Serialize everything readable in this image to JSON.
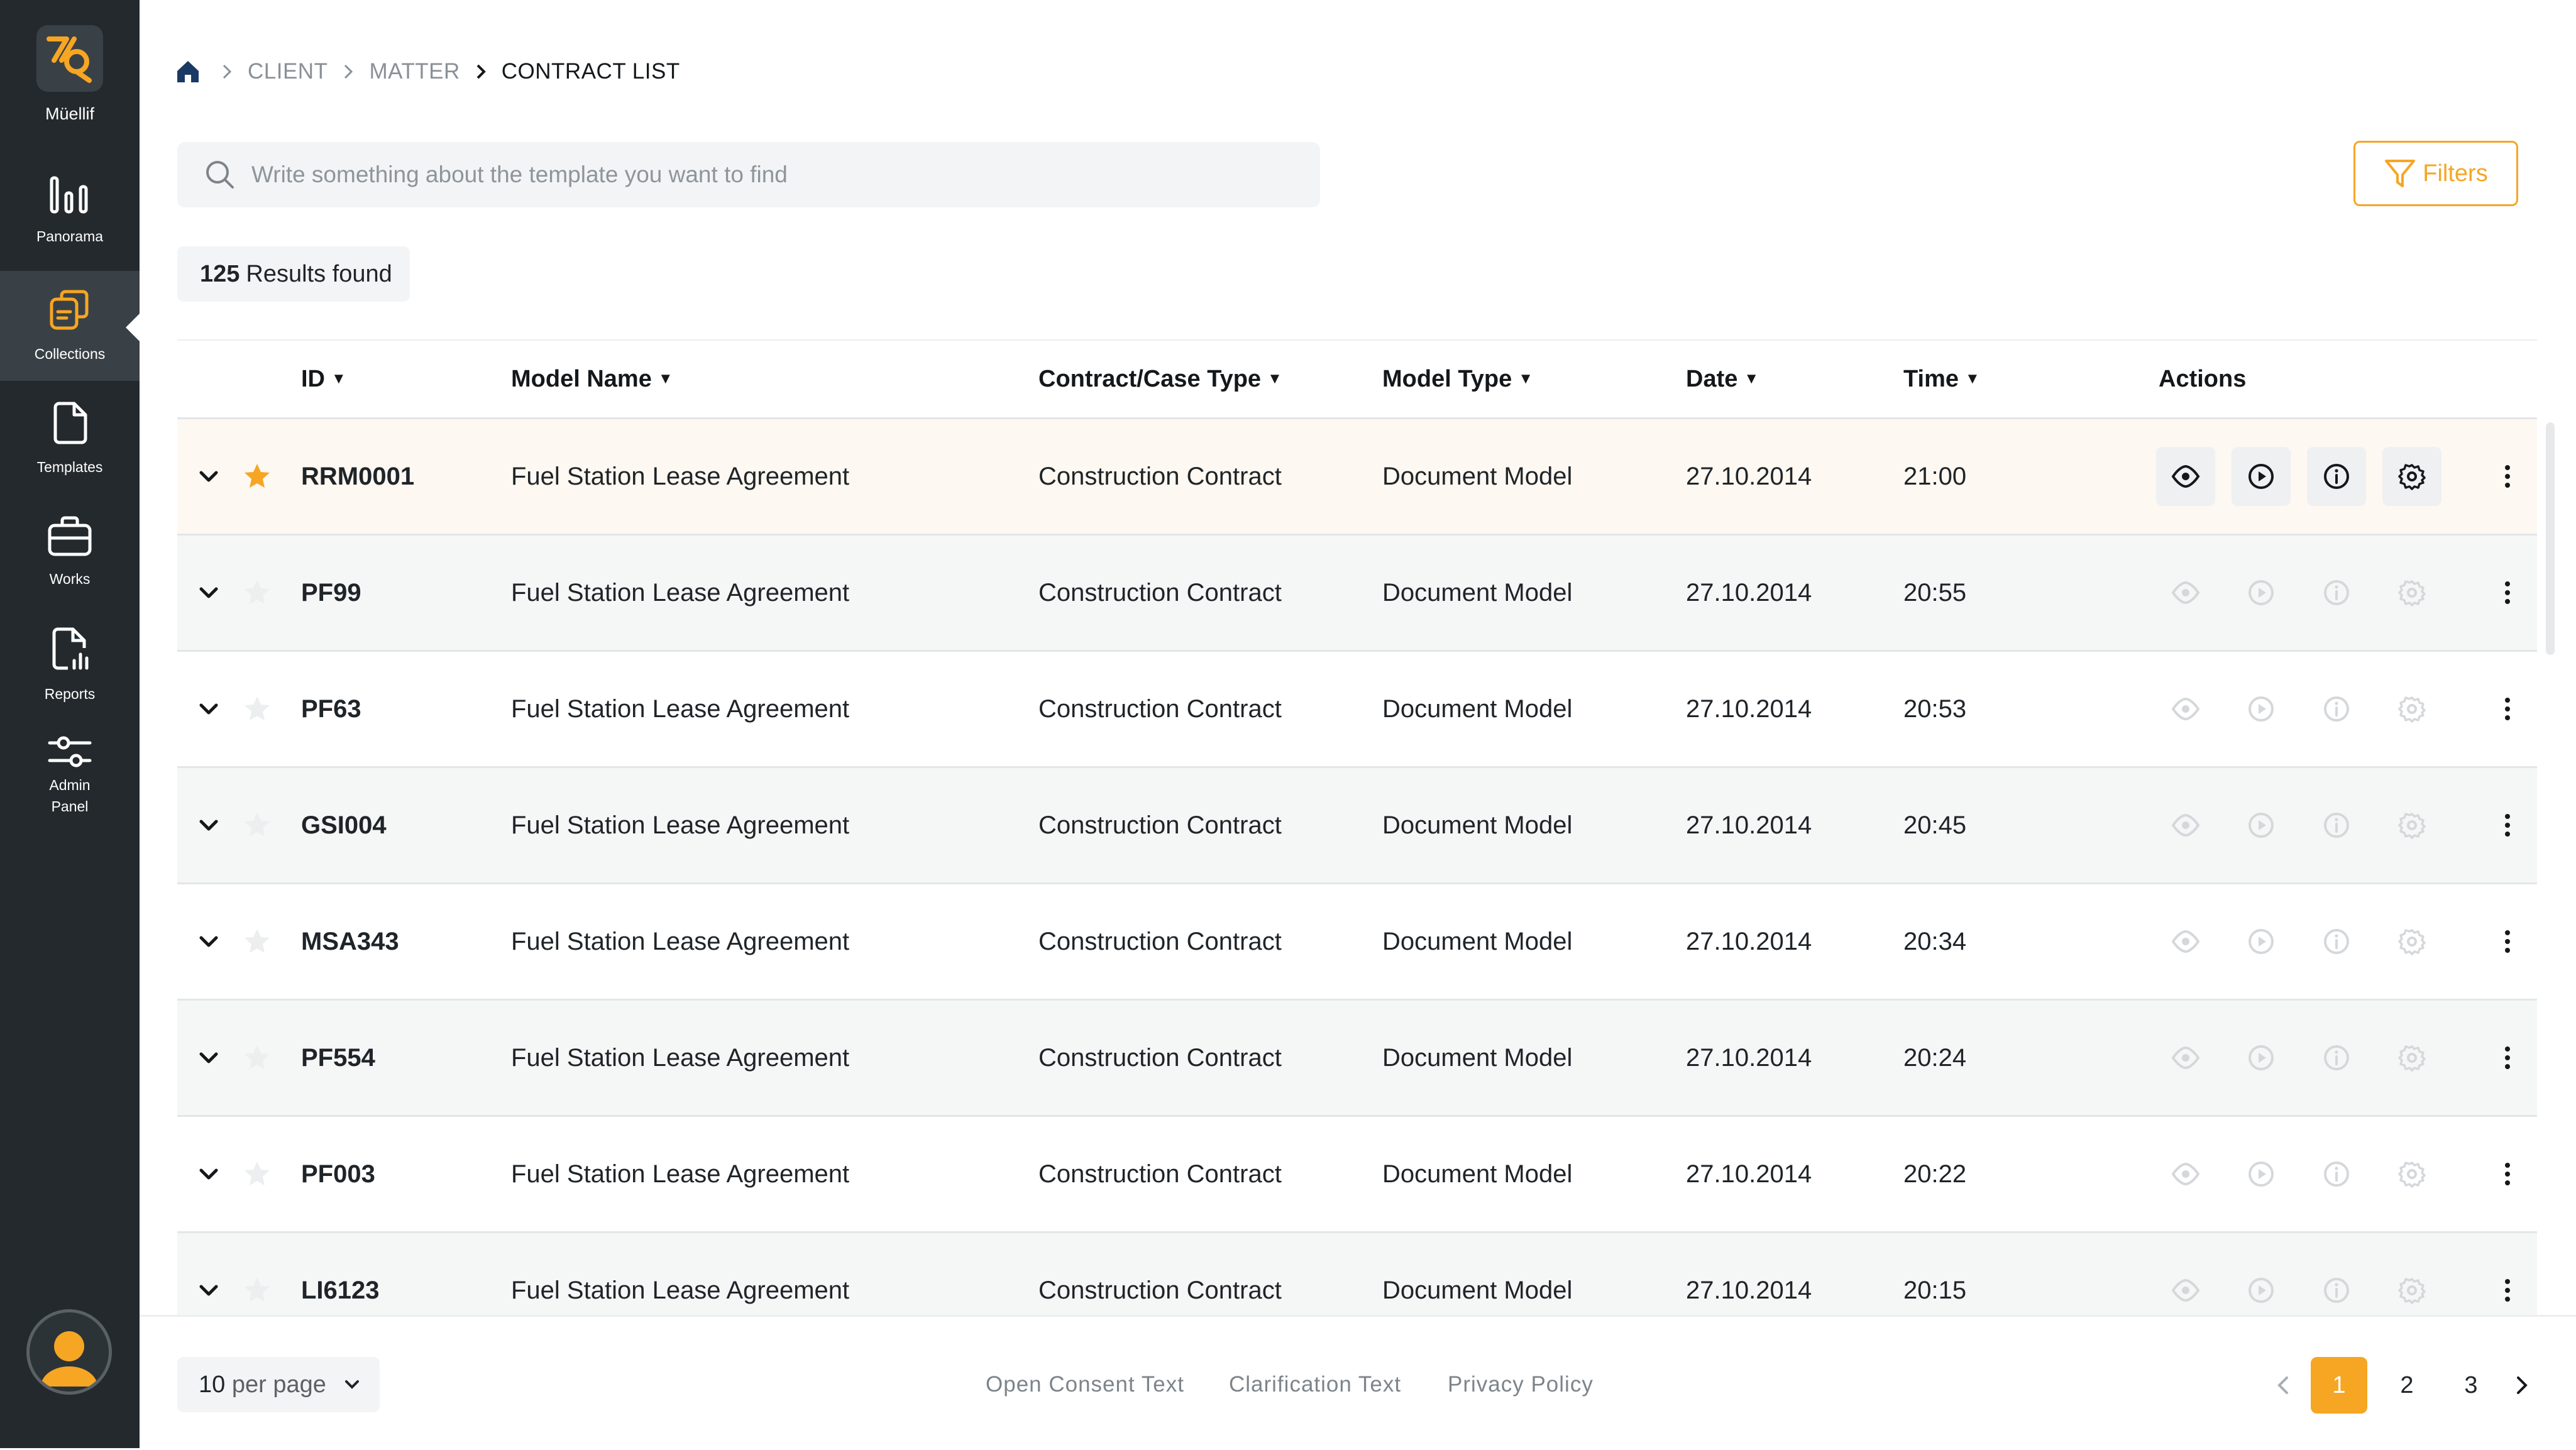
{
  "app": {
    "name": "Müellif",
    "brand_color": "#f6a623",
    "sidebar_color": "#23292d"
  },
  "sidebar": {
    "items": [
      {
        "label": "Panorama",
        "icon": "chart-bars-icon"
      },
      {
        "label": "Collections",
        "icon": "collections-icon",
        "active": true
      },
      {
        "label": "Templates",
        "icon": "document-icon"
      },
      {
        "label": "Works",
        "icon": "briefcase-icon"
      },
      {
        "label": "Reports",
        "icon": "report-icon"
      },
      {
        "label": "Admin Panel",
        "icon": "sliders-icon"
      }
    ]
  },
  "breadcrumb": {
    "items": [
      "CLIENT",
      "MATTER",
      "CONTRACT LIST"
    ]
  },
  "search": {
    "placeholder": "Write something about the template you want to find"
  },
  "filters": {
    "label": "Filters"
  },
  "results": {
    "count": "125",
    "label": "Results found"
  },
  "table": {
    "columns": {
      "id": "ID",
      "model_name": "Model Name",
      "contract_type": "Contract/Case Type",
      "model_type": "Model Type",
      "date": "Date",
      "time": "Time",
      "actions": "Actions"
    },
    "rows": [
      {
        "id": "RRM0001",
        "model_name": "Fuel Station Lease Agreement",
        "contract_type": "Construction Contract",
        "model_type": "Document Model",
        "date": "27.10.2014",
        "time": "21:00",
        "starred": true
      },
      {
        "id": "PF99",
        "model_name": "Fuel Station Lease Agreement",
        "contract_type": "Construction Contract",
        "model_type": "Document Model",
        "date": "27.10.2014",
        "time": "20:55",
        "starred": false
      },
      {
        "id": "PF63",
        "model_name": "Fuel Station Lease Agreement",
        "contract_type": "Construction Contract",
        "model_type": "Document Model",
        "date": "27.10.2014",
        "time": "20:53",
        "starred": false
      },
      {
        "id": "GSI004",
        "model_name": "Fuel Station Lease Agreement",
        "contract_type": "Construction Contract",
        "model_type": "Document Model",
        "date": "27.10.2014",
        "time": "20:45",
        "starred": false
      },
      {
        "id": "MSA343",
        "model_name": "Fuel Station Lease Agreement",
        "contract_type": "Construction Contract",
        "model_type": "Document Model",
        "date": "27.10.2014",
        "time": "20:34",
        "starred": false
      },
      {
        "id": "PF554",
        "model_name": "Fuel Station Lease Agreement",
        "contract_type": "Construction Contract",
        "model_type": "Document Model",
        "date": "27.10.2014",
        "time": "20:24",
        "starred": false
      },
      {
        "id": "PF003",
        "model_name": "Fuel Station Lease Agreement",
        "contract_type": "Construction Contract",
        "model_type": "Document Model",
        "date": "27.10.2014",
        "time": "20:22",
        "starred": false
      },
      {
        "id": "LI6123",
        "model_name": "Fuel Station Lease Agreement",
        "contract_type": "Construction Contract",
        "model_type": "Document Model",
        "date": "27.10.2014",
        "time": "20:15",
        "starred": false
      }
    ]
  },
  "footer": {
    "per_page": {
      "value": "10",
      "label": "per page"
    },
    "links": [
      "Open Consent Text",
      "Clarification Text",
      "Privacy Policy"
    ],
    "pagination": {
      "pages": [
        "1",
        "2",
        "3"
      ],
      "current": "1"
    }
  }
}
